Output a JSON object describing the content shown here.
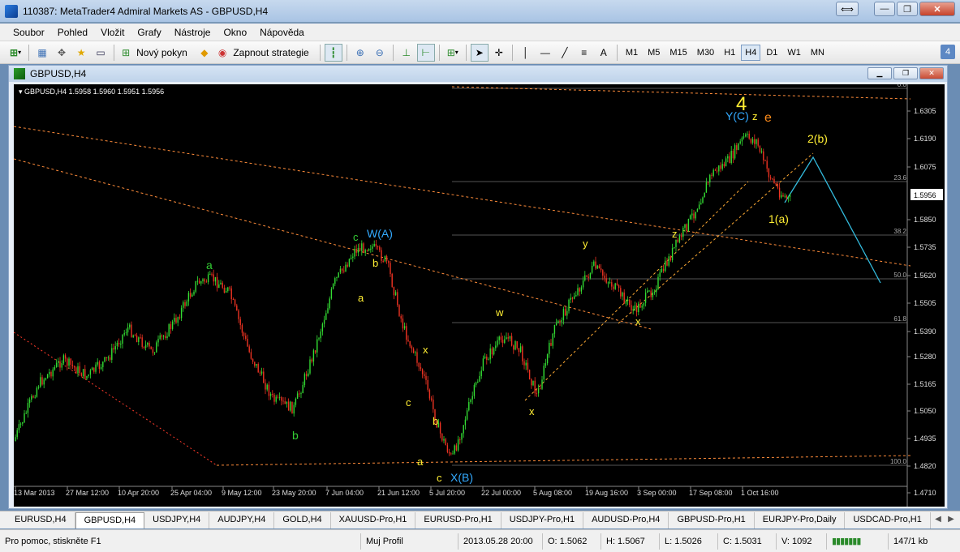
{
  "window": {
    "title": "110387: MetaTrader4 Admiral Markets AS - GBPUSD,H4"
  },
  "menu": [
    "Soubor",
    "Pohled",
    "Vložit",
    "Grafy",
    "Nástroje",
    "Okno",
    "Nápověda"
  ],
  "toolbar": {
    "new_order": "Nový pokyn",
    "start_strategies": "Zapnout strategie",
    "timeframes": [
      "M1",
      "M5",
      "M15",
      "M30",
      "H1",
      "H4",
      "D1",
      "W1",
      "MN"
    ],
    "active_timeframe": "H4",
    "badge": "4"
  },
  "chart_window": {
    "title": "GBPUSD,H4"
  },
  "chart": {
    "header": "GBPUSD,H4  1.5958 1.5960 1.5951 1.5956",
    "current_price": "1.5956",
    "price_ticks": [
      "1.6305",
      "1.6190",
      "1.6075",
      "1.5956",
      "1.5850",
      "1.5735",
      "1.5620",
      "1.5505",
      "1.5390",
      "1.5280",
      "1.5165",
      "1.5050",
      "1.4935",
      "1.4820",
      "1.4710"
    ],
    "date_ticks": [
      "13 Mar 2013",
      "27 Mar 12:00",
      "10 Apr 20:00",
      "25 Apr 04:00",
      "9 May 12:00",
      "23 May 20:00",
      "7 Jun 04:00",
      "21 Jun 12:00",
      "5 Jul 20:00",
      "22 Jul 00:00",
      "5 Aug 08:00",
      "19 Aug 16:00",
      "3 Sep 00:00",
      "17 Sep 08:00",
      "1 Oct 16:00"
    ],
    "fib_levels": [
      "0.0",
      "23.6",
      "38.2",
      "50.0",
      "61.8",
      "100.0"
    ],
    "annotations": [
      {
        "t": "a",
        "c": "#33cc33"
      },
      {
        "t": "b",
        "c": "#33cc33"
      },
      {
        "t": "c",
        "c": "#33cc33"
      },
      {
        "t": "W(A)",
        "c": "#33aaff"
      },
      {
        "t": "b",
        "c": "#ffee33"
      },
      {
        "t": "a",
        "c": "#ffee33"
      },
      {
        "t": "x",
        "c": "#ffee33"
      },
      {
        "t": "c",
        "c": "#ffee33"
      },
      {
        "t": "b",
        "c": "#ffee33"
      },
      {
        "t": "a",
        "c": "#ffee33"
      },
      {
        "t": "c",
        "c": "#ffee33"
      },
      {
        "t": "X(B)",
        "c": "#33aaff"
      },
      {
        "t": "w",
        "c": "#ffee33"
      },
      {
        "t": "x",
        "c": "#ffee33"
      },
      {
        "t": "y",
        "c": "#ffee33"
      },
      {
        "t": "x",
        "c": "#ffee33"
      },
      {
        "t": "z",
        "c": "#ffee33"
      },
      {
        "t": "4",
        "c": "#ffee33"
      },
      {
        "t": "Y(C)",
        "c": "#33aaff"
      },
      {
        "t": "z",
        "c": "#ffee33"
      },
      {
        "t": "e",
        "c": "#ff8c1a"
      },
      {
        "t": "2(b)",
        "c": "#ffee33"
      },
      {
        "t": "1(a)",
        "c": "#ffee33"
      }
    ]
  },
  "sheet_tabs": [
    "EURUSD,H4",
    "GBPUSD,H4",
    "USDJPY,H4",
    "AUDJPY,H4",
    "GOLD,H4",
    "XAUUSD-Pro,H1",
    "EURUSD-Pro,H1",
    "USDJPY-Pro,H1",
    "AUDUSD-Pro,H4",
    "GBPUSD-Pro,H1",
    "EURJPY-Pro,Daily",
    "USDCAD-Pro,H1"
  ],
  "active_sheet": "GBPUSD,H4",
  "status": {
    "help": "Pro pomoc, stiskněte F1",
    "profile": "Muj Profil",
    "datetime": "2013.05.28 20:00",
    "open": "O: 1.5062",
    "high": "H: 1.5067",
    "low": "L: 1.5026",
    "close": "C: 1.5031",
    "volume": "V: 1092",
    "traffic": "147/1 kb"
  }
}
